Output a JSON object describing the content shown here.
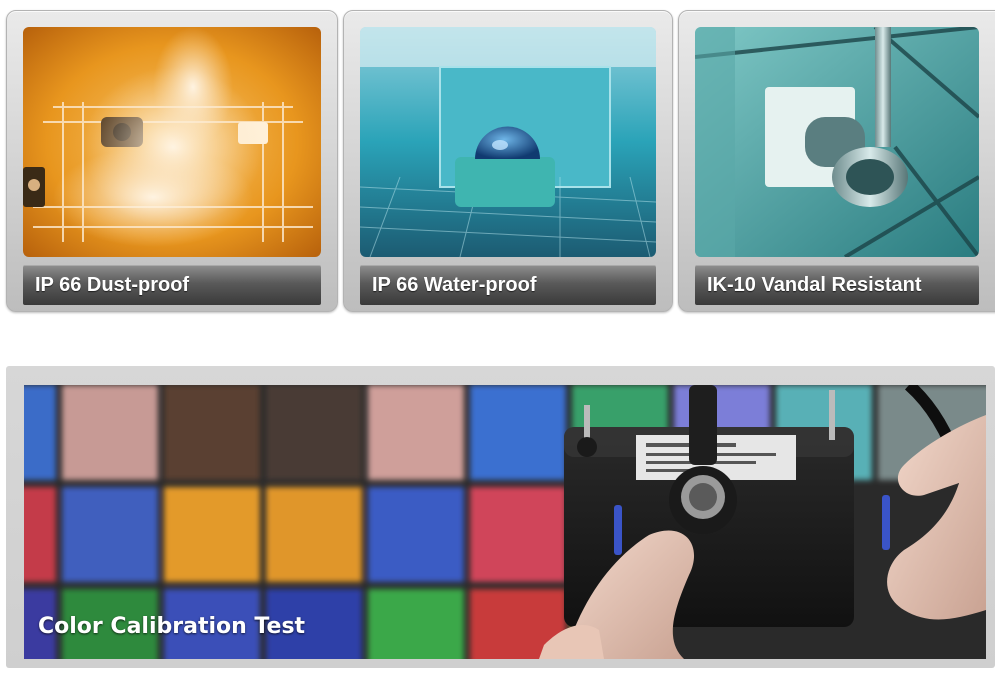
{
  "tests": [
    {
      "label": "IP 66 Dust-proof",
      "image": "dust-chamber-photo"
    },
    {
      "label": "IP 66 Water-proof",
      "image": "water-spray-photo"
    },
    {
      "label": "IK-10 Vandal Resistant",
      "image": "impact-test-photo"
    }
  ],
  "banner": {
    "label": "Color Calibration Test",
    "image": "color-chart-calibration-photo"
  },
  "colors": {
    "dust_tone": "#e8961e",
    "water_tone": "#2aa3b8",
    "impact_tone": "#3a9a9e",
    "caption_bar": "#4a4a4a",
    "card_frame": "#d2d2d2"
  }
}
